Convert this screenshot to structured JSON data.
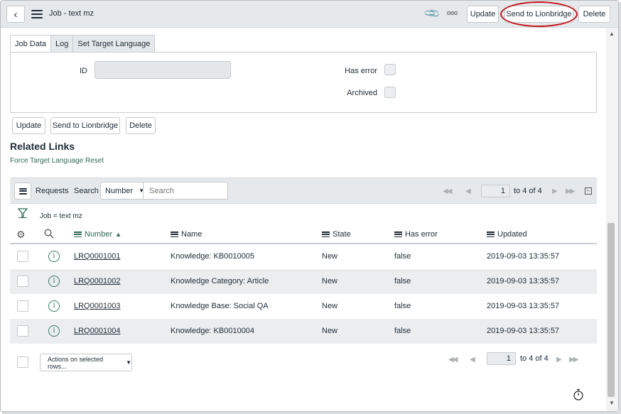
{
  "header": {
    "back_icon": "back-arrow-icon",
    "title": "Job - text mz",
    "update_label": "Update",
    "send_label": "Send to Lionbridge",
    "delete_label": "Delete",
    "more_glyph": "ooo",
    "annotation_color": "#c1141a"
  },
  "tabs": [
    {
      "label": "Job Data"
    },
    {
      "label": "Log"
    },
    {
      "label": "Set Target Language"
    }
  ],
  "form": {
    "id_label": "ID",
    "id_value": "",
    "has_error_label": "Has error",
    "archived_label": "Archived"
  },
  "form_buttons": {
    "update_label": "Update",
    "send_label": "Send to Lionbridge",
    "delete_label": "Delete"
  },
  "related_links": {
    "title": "Related Links",
    "items": [
      {
        "label": "Force Target Language Reset"
      }
    ]
  },
  "list": {
    "title": "Requests",
    "search_label": "Search",
    "search_field": "Number",
    "search_placeholder": "Search",
    "page_value": "1",
    "page_range": "to 4 of 4",
    "filter_text": "Job = text mz",
    "columns": [
      "Number",
      "Name",
      "State",
      "Has error",
      "Updated"
    ],
    "sort_indicator": "▲",
    "rows": [
      {
        "number": "LRQ0001001",
        "name": "Knowledge: KB0010005",
        "state": "New",
        "has_error": "false",
        "updated": "2019-09-03 13:35:57"
      },
      {
        "number": "LRQ0001002",
        "name": "Knowledge Category: Article",
        "state": "New",
        "has_error": "false",
        "updated": "2019-09-03 13:35:57"
      },
      {
        "number": "LRQ0001003",
        "name": "Knowledge Base: Social QA",
        "state": "New",
        "has_error": "false",
        "updated": "2019-09-03 13:35:57"
      },
      {
        "number": "LRQ0001004",
        "name": "Knowledge: KB0010004",
        "state": "New",
        "has_error": "false",
        "updated": "2019-09-03 13:35:57"
      }
    ]
  },
  "footer": {
    "actions_label": "Actions on selected rows...",
    "page_value": "1",
    "page_range": "to 4 of 4"
  },
  "accent_color": "#2e6b56"
}
